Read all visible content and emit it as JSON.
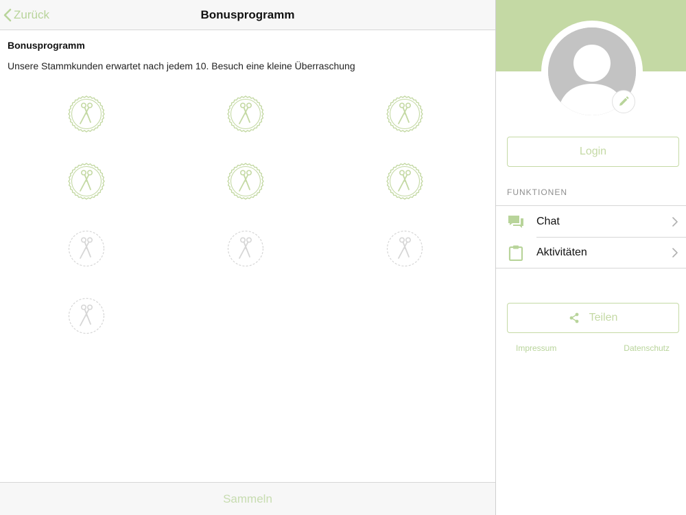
{
  "navbar": {
    "back_label": "Zurück",
    "title": "Bonusprogramm"
  },
  "content": {
    "title": "Bonusprogramm",
    "description": "Unsere Stammkunden erwartet nach jedem 10. Besuch eine kleine Überraschung"
  },
  "stamps": {
    "total": 10,
    "collected": 6,
    "icon": "scissors-icon",
    "active_color": "#c4d9a4",
    "inactive_color": "#d6d6d6"
  },
  "footer": {
    "collect_label": "Sammeln"
  },
  "sidebar": {
    "header_color": "#c4d9a4",
    "login_label": "Login",
    "section_label": "FUNKTIONEN",
    "menu": [
      {
        "label": "Chat",
        "icon": "chat-icon"
      },
      {
        "label": "Aktivitäten",
        "icon": "clipboard-icon"
      }
    ],
    "share_label": "Teilen",
    "links": {
      "impressum": "Impressum",
      "datenschutz": "Datenschutz"
    }
  },
  "colors": {
    "accent": "#c4d9a4",
    "accent_text": "#b8d49a"
  }
}
